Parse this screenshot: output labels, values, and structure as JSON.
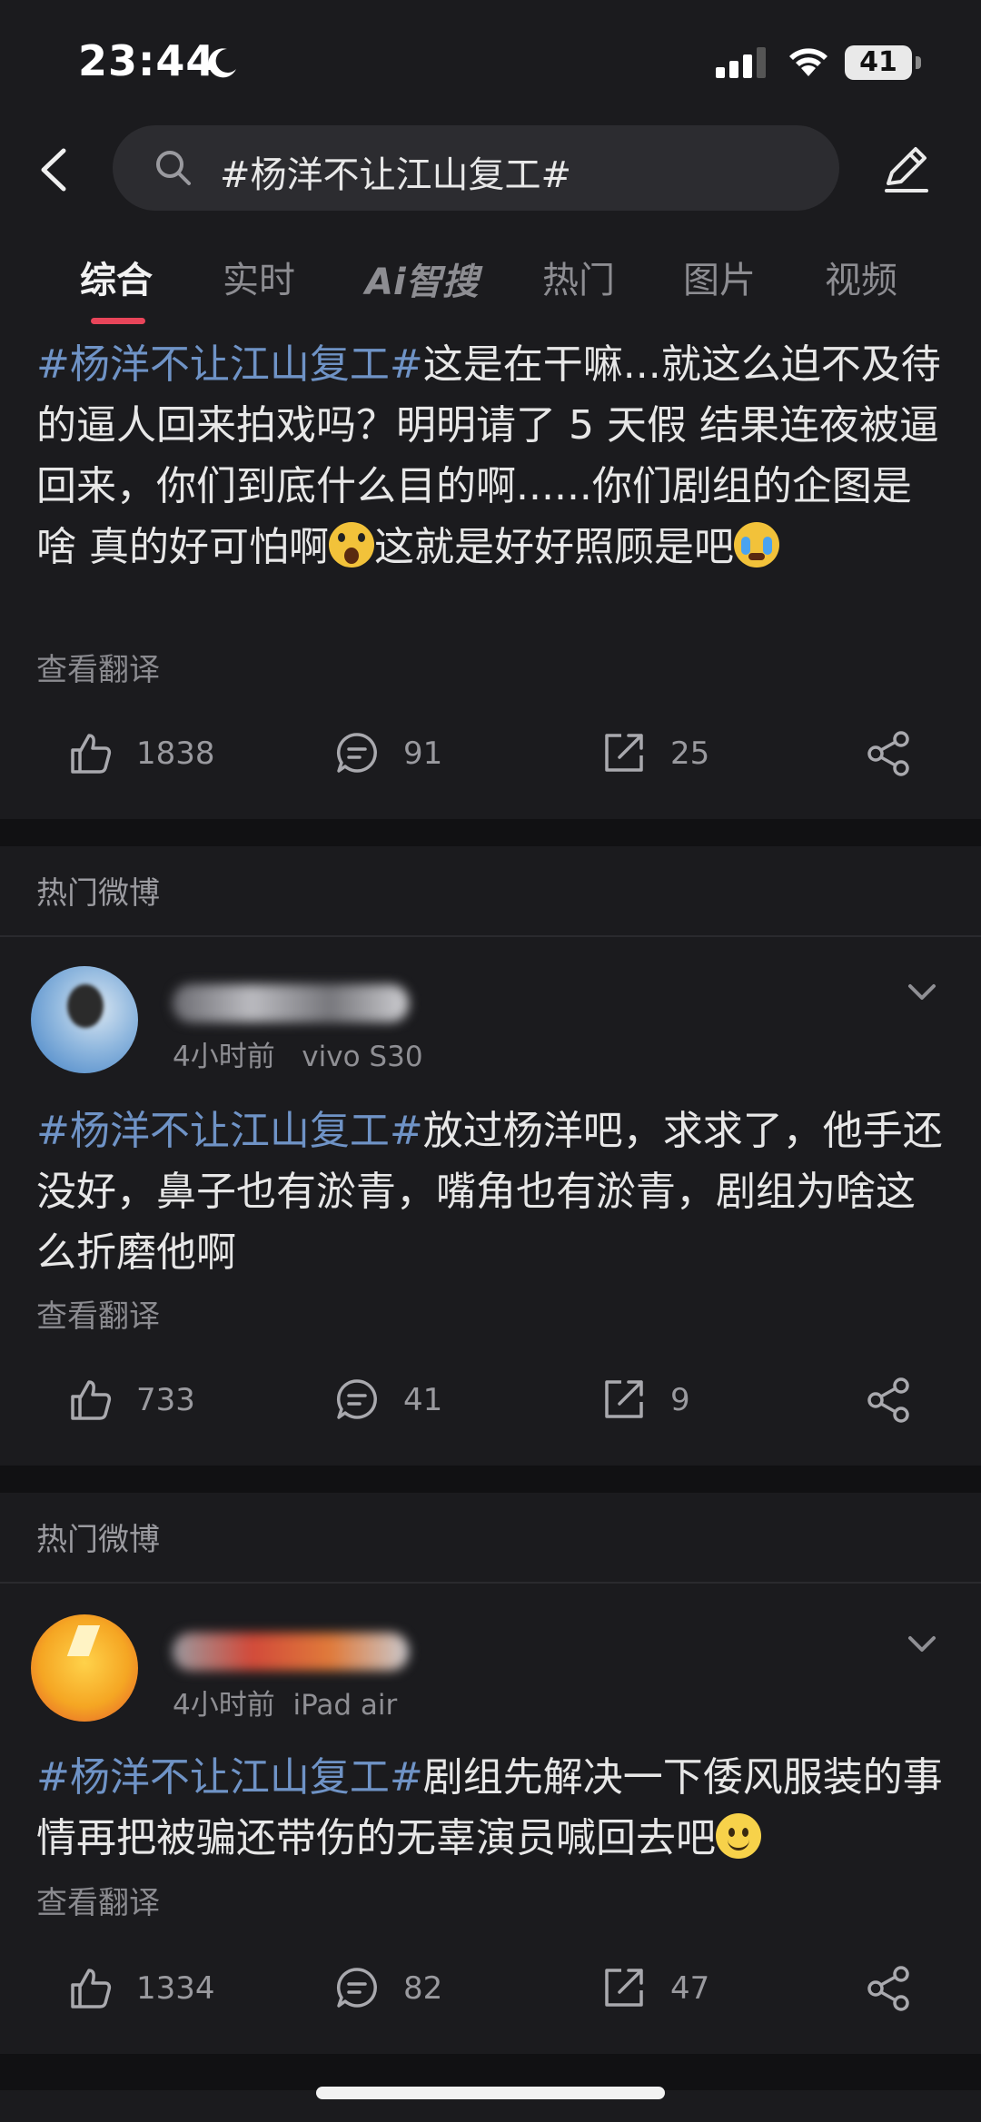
{
  "status_bar": {
    "time": "23:44",
    "battery": "41"
  },
  "search": {
    "query": "#杨洋不让江山复工#"
  },
  "tabs": [
    {
      "label": "综合"
    },
    {
      "label": "实时"
    },
    {
      "label": "Ai智搜"
    },
    {
      "label": "热门"
    },
    {
      "label": "图片"
    },
    {
      "label": "视频"
    }
  ],
  "posts": [
    {
      "hashtag": "#杨洋不让江山复工#",
      "text_a": "这是在干嘛...就这么迫不及待的逼人回来拍戏吗？明明请了 5 天假 结果连夜被逼回来，你们到底什么目的啊......你们剧组的企图是啥 真的好可怕啊",
      "text_b": "这就是好好照顾是吧",
      "translate": "查看翻译",
      "likes": "1838",
      "comments": "91",
      "reposts": "25"
    },
    {
      "section": "热门微博",
      "time": "4小时前",
      "device": "vivo S30",
      "hashtag": "#杨洋不让江山复工#",
      "text_a": "放过杨洋吧，求求了，他手还没好，鼻子也有淤青，嘴角也有淤青，剧组为啥这么折磨他啊",
      "translate": "查看翻译",
      "likes": "733",
      "comments": "41",
      "reposts": "9"
    },
    {
      "section": "热门微博",
      "time": "4小时前",
      "device": "iPad air",
      "hashtag": "#杨洋不让江山复工#",
      "text_a": "剧组先解决一下倭风服装的事情再把被骗还带伤的无辜演员喊回去吧",
      "translate": "查看翻译",
      "likes": "1334",
      "comments": "82",
      "reposts": "47"
    }
  ],
  "colors": {
    "accent": "#e8455a",
    "hashtag": "#6f93c6",
    "background": "#1b1b1e"
  }
}
